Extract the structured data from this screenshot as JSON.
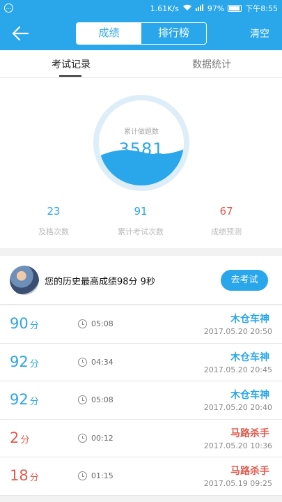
{
  "status_bar": {
    "speed": "1.61K/s",
    "battery": "97%",
    "time": "下午8:55"
  },
  "header": {
    "back_icon": "back-arrow-icon",
    "tabs": [
      {
        "label": "成绩"
      },
      {
        "label": "排行榜"
      }
    ],
    "clear_label": "清空"
  },
  "sub_tabs": [
    {
      "label": "考试记录"
    },
    {
      "label": "数据统计"
    }
  ],
  "gauge": {
    "label": "累计做题数",
    "value": "3581"
  },
  "stats": [
    {
      "value": "23",
      "label": "及格次数"
    },
    {
      "value": "91",
      "label": "累计考试次数"
    },
    {
      "value": "67",
      "label": "成绩预测"
    }
  ],
  "best": {
    "text": "您的历史最高成绩98分 9秒",
    "button": "去考试"
  },
  "records": [
    {
      "score": "90",
      "unit": "分",
      "duration": "05:08",
      "title": "木仓车神",
      "date": "2017.05.20  20:50",
      "color": "#2aa6ea"
    },
    {
      "score": "92",
      "unit": "分",
      "duration": "04:34",
      "title": "木仓车神",
      "date": "2017.05.20  20:45",
      "color": "#2aa6ea"
    },
    {
      "score": "92",
      "unit": "分",
      "duration": "05:08",
      "title": "木仓车神",
      "date": "2017.05.20  20:40",
      "color": "#2aa6ea"
    },
    {
      "score": "2",
      "unit": "分",
      "duration": "00:12",
      "title": "马路杀手",
      "date": "2017.05.20  10:36",
      "color": "#e05a4e"
    },
    {
      "score": "18",
      "unit": "分",
      "duration": "01:15",
      "title": "马路杀手",
      "date": "2017.05.19  09:25",
      "color": "#e05a4e"
    }
  ]
}
